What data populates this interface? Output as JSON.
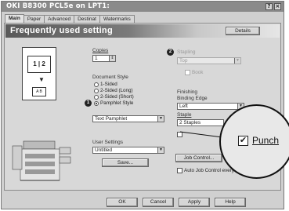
{
  "window": {
    "title": "OKI B8300 PCL5e on LPT1:",
    "controls": [
      "?",
      "×"
    ]
  },
  "tabs": [
    {
      "label": "Main",
      "active": true
    },
    {
      "label": "Paper",
      "active": false
    },
    {
      "label": "Advanced",
      "active": false
    },
    {
      "label": "Destinat",
      "active": false
    },
    {
      "label": "Watermarks",
      "active": false
    }
  ],
  "banner": {
    "title": "Frequently used setting"
  },
  "buttons": {
    "details": "Details",
    "save": "Save...",
    "job_control": "Job Control...",
    "ok": "OK",
    "cancel": "Cancel",
    "apply": "Apply",
    "help": "Help"
  },
  "preview": {
    "pages": "1 | 2",
    "page_label": "A B"
  },
  "copies": {
    "label": "Copies",
    "value": "1"
  },
  "document_style": {
    "label": "Document Style",
    "options": [
      {
        "label": "1-Sided",
        "selected": false
      },
      {
        "label": "2-Sided (Long)",
        "selected": false
      },
      {
        "label": "2-Sided (Short)",
        "selected": false
      },
      {
        "label": "Pamphlet Style",
        "selected": true
      }
    ],
    "pamphlet_select": "Text Pamphlet"
  },
  "user_settings": {
    "label": "User Settings",
    "value": "Untitled"
  },
  "stapling": {
    "label": "Stapling",
    "value": "Top",
    "booklet_label": "Book"
  },
  "finishing": {
    "label": "Finishing",
    "edge_label": "Binding Edge",
    "edge_value": "Left",
    "staple_label": "Staple",
    "staple_value": "2 Staples",
    "punch_label": "Punch",
    "punch_checked": true
  },
  "auto_job": {
    "label": "Auto Job Control every"
  },
  "callouts": [
    "1",
    "2"
  ],
  "icons": {
    "magnifier": "magnifier-lens-icon",
    "printer": "printer-device-icon"
  }
}
